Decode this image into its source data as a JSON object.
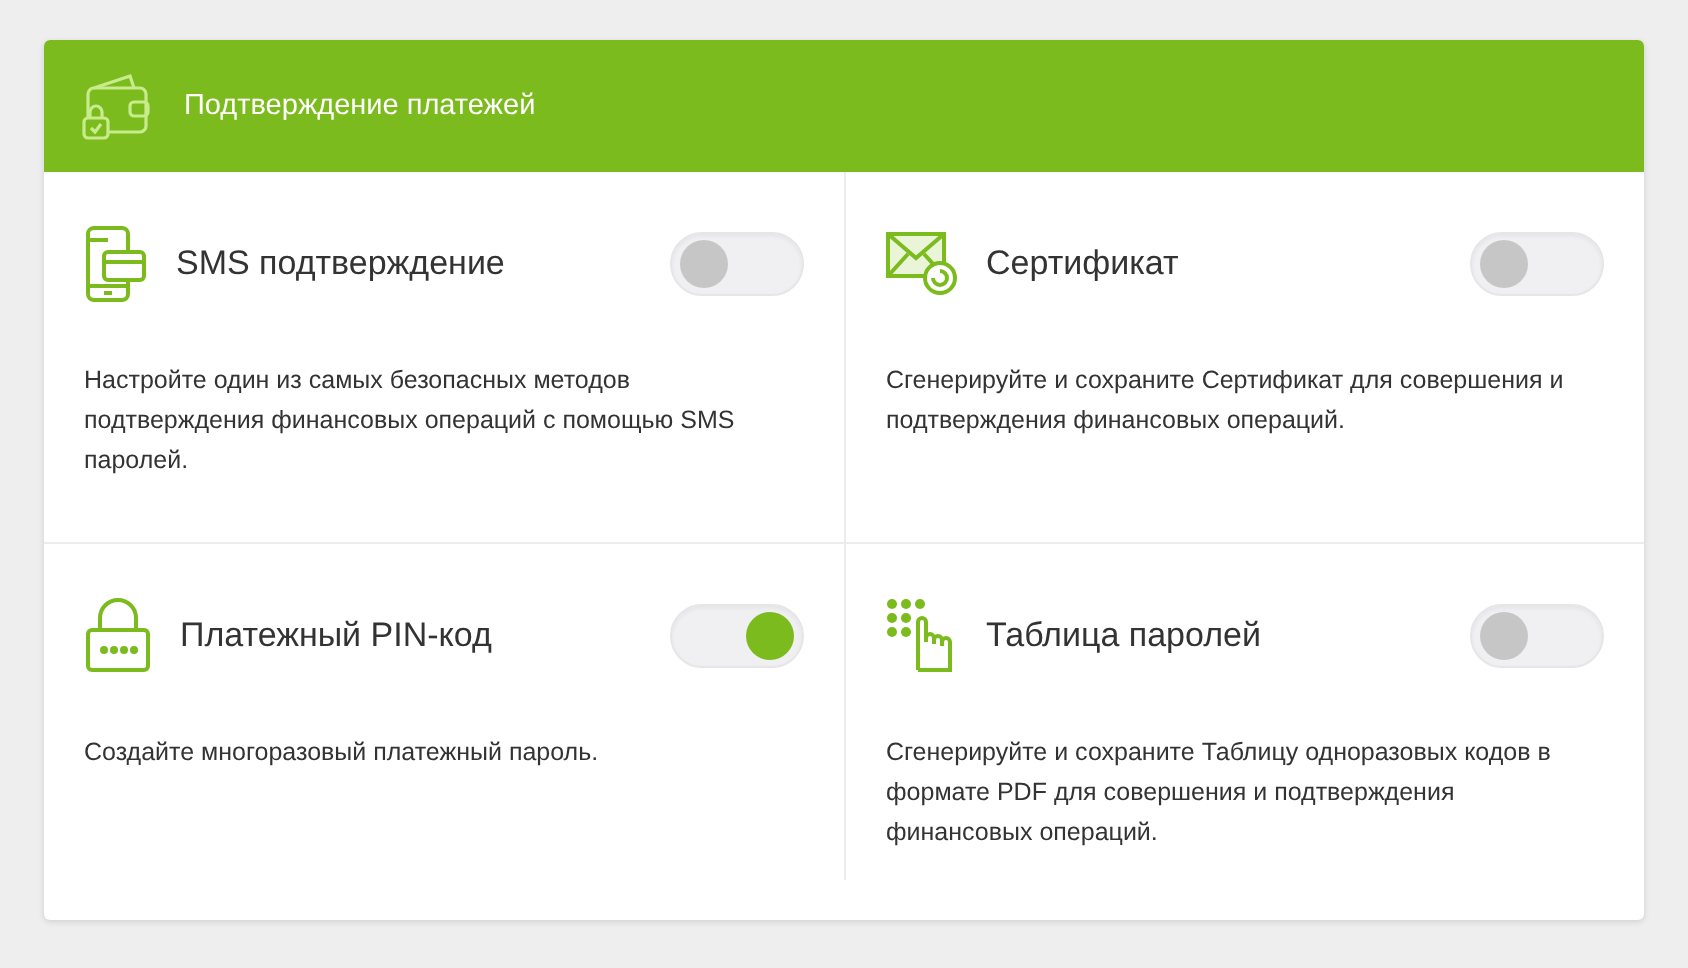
{
  "header": {
    "title": "Подтверждение платежей"
  },
  "methods": [
    {
      "kind": "phone",
      "title": "SMS подтверждение",
      "on": false,
      "description": "Настройте один из самых безопасных методов подтверждения финансовых операций с помощью SMS паролей."
    },
    {
      "kind": "certificate",
      "title": "Сертификат",
      "on": false,
      "description": "Сгенерируйте и сохраните Сертификат для совершения и подтверждения финансовых операций."
    },
    {
      "kind": "lock",
      "title": "Платежный PIN-код",
      "on": true,
      "description": "Создайте многоразовый платежный пароль."
    },
    {
      "kind": "keypad",
      "title": "Таблица паролей",
      "on": false,
      "description": "Сгенерируйте и сохраните Таблицу одноразовых кодов в формате PDF для совершения и подтверждения финансовых операций."
    }
  ]
}
